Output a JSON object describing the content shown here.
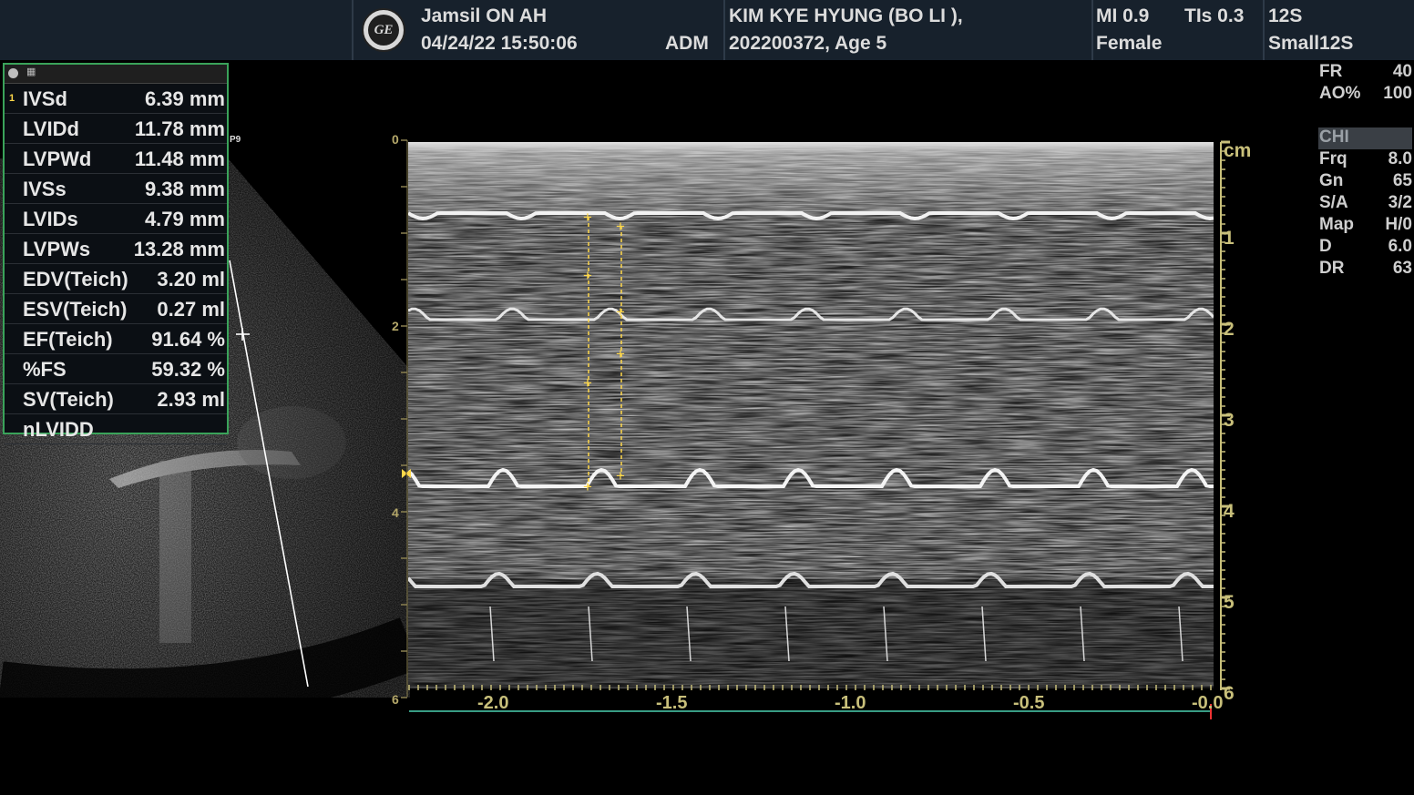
{
  "header": {
    "site": "Jamsil ON AH",
    "datetime": "04/24/22 15:50:06",
    "operator": "ADM",
    "patient_name": "KIM KYE HYUNG (BO LI ),",
    "patient_id_age": "202200372, Age 5",
    "mi": "MI 0.9",
    "tis": "TIs 0.3",
    "sex": "Female",
    "probe": "12S",
    "preset": "Small12S",
    "logo_icon": "ge-logo-icon"
  },
  "measurements": {
    "probe_tag": "P9",
    "rows": [
      {
        "num": "1",
        "label": "IVSd",
        "value": "6.39 mm"
      },
      {
        "num": "",
        "label": "LVIDd",
        "value": "11.78 mm"
      },
      {
        "num": "",
        "label": "LVPWd",
        "value": "11.48 mm"
      },
      {
        "num": "",
        "label": "IVSs",
        "value": "9.38 mm"
      },
      {
        "num": "",
        "label": "LVIDs",
        "value": "4.79 mm"
      },
      {
        "num": "",
        "label": "LVPWs",
        "value": "13.28 mm"
      },
      {
        "num": "",
        "label": "EDV(Teich)",
        "value": "3.20 ml"
      },
      {
        "num": "",
        "label": "ESV(Teich)",
        "value": "0.27 ml"
      },
      {
        "num": "",
        "label": "EF(Teich)",
        "value": "91.64 %"
      },
      {
        "num": "",
        "label": "%FS",
        "value": "59.32 %"
      },
      {
        "num": "",
        "label": "SV(Teich)",
        "value": "2.93 ml"
      },
      {
        "num": "",
        "label": "nLVIDD",
        "value": ""
      }
    ]
  },
  "params": {
    "top": [
      {
        "k": "FR",
        "v": "40"
      },
      {
        "k": "AO%",
        "v": "100"
      }
    ],
    "mode": "CHI",
    "list": [
      {
        "k": "Frq",
        "v": "8.0"
      },
      {
        "k": "Gn",
        "v": "65"
      },
      {
        "k": "S/A",
        "v": "3/2"
      },
      {
        "k": "Map",
        "v": "H/0"
      },
      {
        "k": "D",
        "v": "6.0"
      },
      {
        "k": "DR",
        "v": "63"
      }
    ]
  },
  "mmode": {
    "unit": "cm",
    "depth_labels": [
      "1",
      "2",
      "3",
      "4",
      "5",
      "6"
    ],
    "left_depth_labels": [
      "0",
      "2",
      "4",
      "6"
    ],
    "time_labels": [
      "-2.0",
      "-1.5",
      "-1.0",
      "-0.5",
      "-0.0"
    ],
    "accent": "#ffd84a"
  }
}
